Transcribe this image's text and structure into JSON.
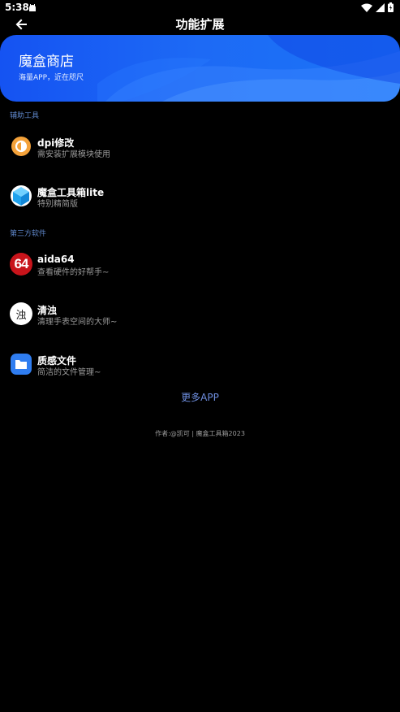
{
  "status_bar": {
    "time": "5:38"
  },
  "app_bar": {
    "title": "功能扩展"
  },
  "banner": {
    "title": "魔盒商店",
    "subtitle": "海量APP，近在咫尺",
    "colors": {
      "start": "#1553f2",
      "end": "#1b74f7"
    }
  },
  "sections": [
    {
      "header": "辅助工具",
      "items": [
        {
          "title": "dpi修改",
          "subtitle": "需安装扩展模块使用",
          "icon": "dpi-icon"
        },
        {
          "title": "魔盒工具箱lite",
          "subtitle": "特别精简版",
          "icon": "cube-icon"
        }
      ]
    },
    {
      "header": "第三方软件",
      "items": [
        {
          "title": "aida64",
          "subtitle": "查看硬件的好帮手~",
          "icon": "aida64-icon",
          "icon_text": "64"
        },
        {
          "title": "清浊",
          "subtitle": "清理手表空间的大师~",
          "icon": "qingzhuo-icon",
          "icon_text": "浊"
        },
        {
          "title": "质感文件",
          "subtitle": "简洁的文件管理~",
          "icon": "folder-icon"
        }
      ]
    }
  ],
  "more_link": "更多APP",
  "footer": "作者:@凯可 | 魔盒工具箱2023"
}
